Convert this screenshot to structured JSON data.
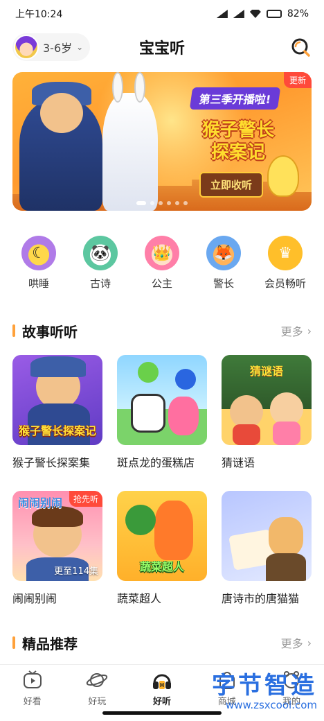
{
  "status_bar": {
    "time": "上午10:24",
    "battery": "82%",
    "battery_level": 0.82
  },
  "header": {
    "age_filter": "3-6岁",
    "title": "宝宝听"
  },
  "banner": {
    "tag": "更新",
    "subtitle": "第三季开播啦!",
    "title_line1": "猴子警长",
    "title_line2": "探案记",
    "cta": "立即收听",
    "page_count": 6,
    "active_index": 0
  },
  "categories": [
    {
      "label": "哄睡",
      "icon": "moon-sleep-icon"
    },
    {
      "label": "古诗",
      "icon": "panda-poem-icon"
    },
    {
      "label": "公主",
      "icon": "princess-icon"
    },
    {
      "label": "警长",
      "icon": "police-chief-icon"
    },
    {
      "label": "会员畅听",
      "icon": "vip-crown-icon"
    }
  ],
  "section_stories": {
    "title": "故事听听",
    "more": "更多"
  },
  "stories": [
    {
      "title": "猴子警长探案集",
      "cover_text": "猴子警长探案记"
    },
    {
      "title": "斑点龙的蛋糕店"
    },
    {
      "title": "猜谜语",
      "cover_text": "猜谜语"
    },
    {
      "title": "闹闹别闹",
      "badge": "抢先听",
      "count": "更至114集",
      "cover_text": "闹闹别闹"
    },
    {
      "title": "蔬菜超人",
      "cover_text": "蔬菜超人"
    },
    {
      "title": "唐诗市的唐猫猫"
    }
  ],
  "section_featured": {
    "title": "精品推荐",
    "more": "更多"
  },
  "tabs": [
    {
      "label": "好看",
      "icon": "tv-icon"
    },
    {
      "label": "好玩",
      "icon": "planet-icon"
    },
    {
      "label": "好听",
      "icon": "headphones-icon",
      "active": true
    },
    {
      "label": "商城",
      "icon": "shop-icon"
    },
    {
      "label": "我的",
      "icon": "profile-icon"
    }
  ],
  "watermark": {
    "line1": "字节智造",
    "line2": "www.zsxcool.com"
  }
}
